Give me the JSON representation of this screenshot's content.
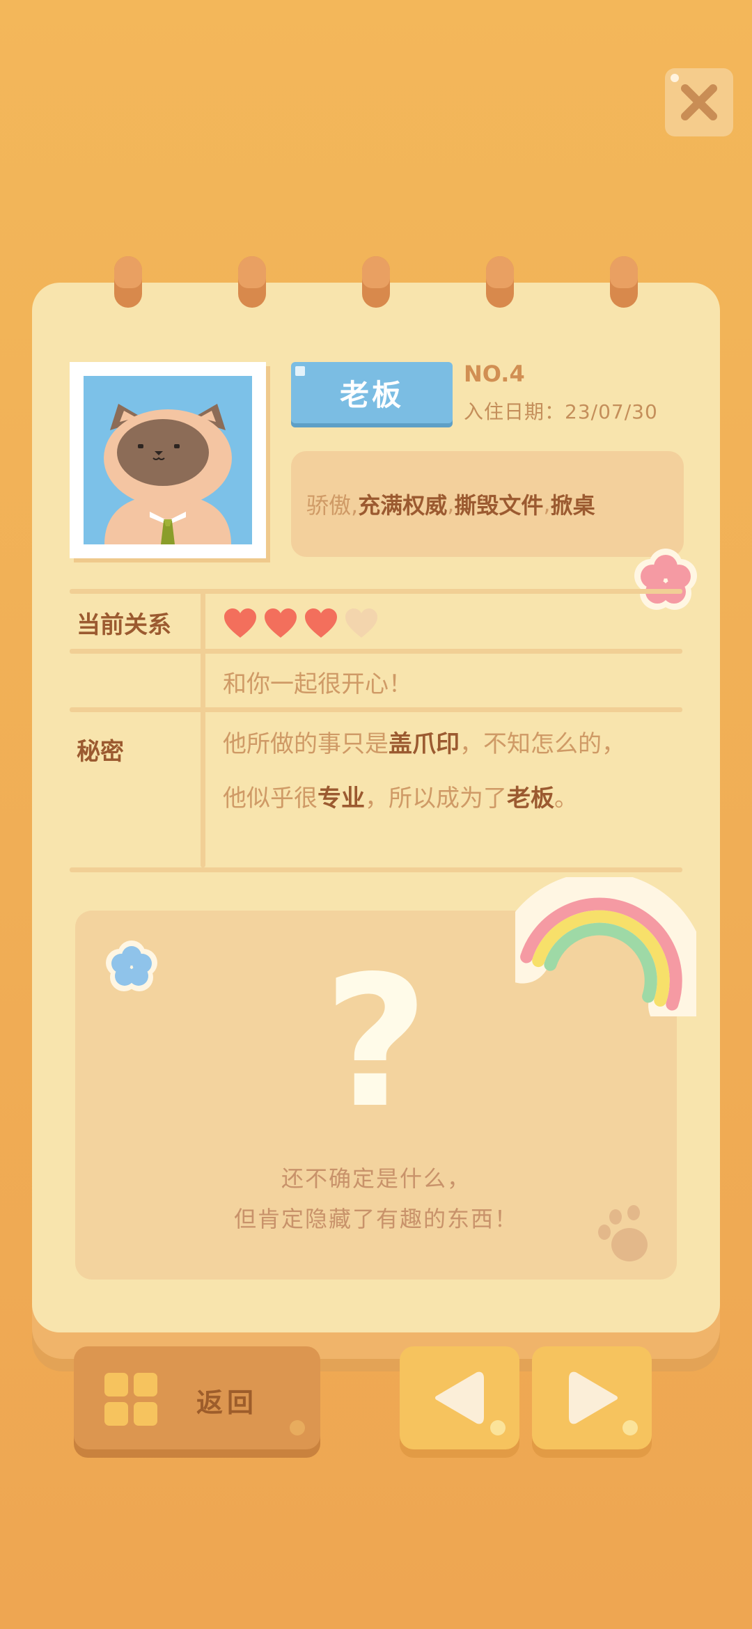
{
  "character": {
    "name": "老板",
    "number": "NO.4",
    "checkin_date": "入住日期：23/07/30",
    "traits": {
      "first": "骄傲, ",
      "second": "充满权威",
      "sep1": ", ",
      "third": "撕毁文件",
      "sep2": ", ",
      "fourth": "掀桌"
    }
  },
  "relationship": {
    "label": "当前关系",
    "hearts_filled": 3,
    "hearts_total": 4,
    "comment": "和你一起很开心！"
  },
  "secret": {
    "label": "秘密",
    "line1_a": "他所做的事只是",
    "line1_b": "盖爪印",
    "line1_c": "，不知怎么的，",
    "line2_a": "他似乎很",
    "line2_b": "专业",
    "line2_c": "，所以成为了",
    "line2_d": "老板",
    "line2_e": "。"
  },
  "mystery": {
    "symbol": "?",
    "line1": "还不确定是什么，",
    "line2": "但肯定隐藏了有趣的东西！"
  },
  "buttons": {
    "back": "返回",
    "prev_icon": "triangle-left-icon",
    "next_icon": "triangle-right-icon",
    "close_icon": "close-x-icon"
  },
  "colors": {
    "background": "#f3b75a",
    "page": "#f8e4ad",
    "name_tag": "#7bbde3",
    "heart_filled": "#f36f5c",
    "heart_empty": "#f3d5ad",
    "nav_button": "#f6c35e"
  }
}
